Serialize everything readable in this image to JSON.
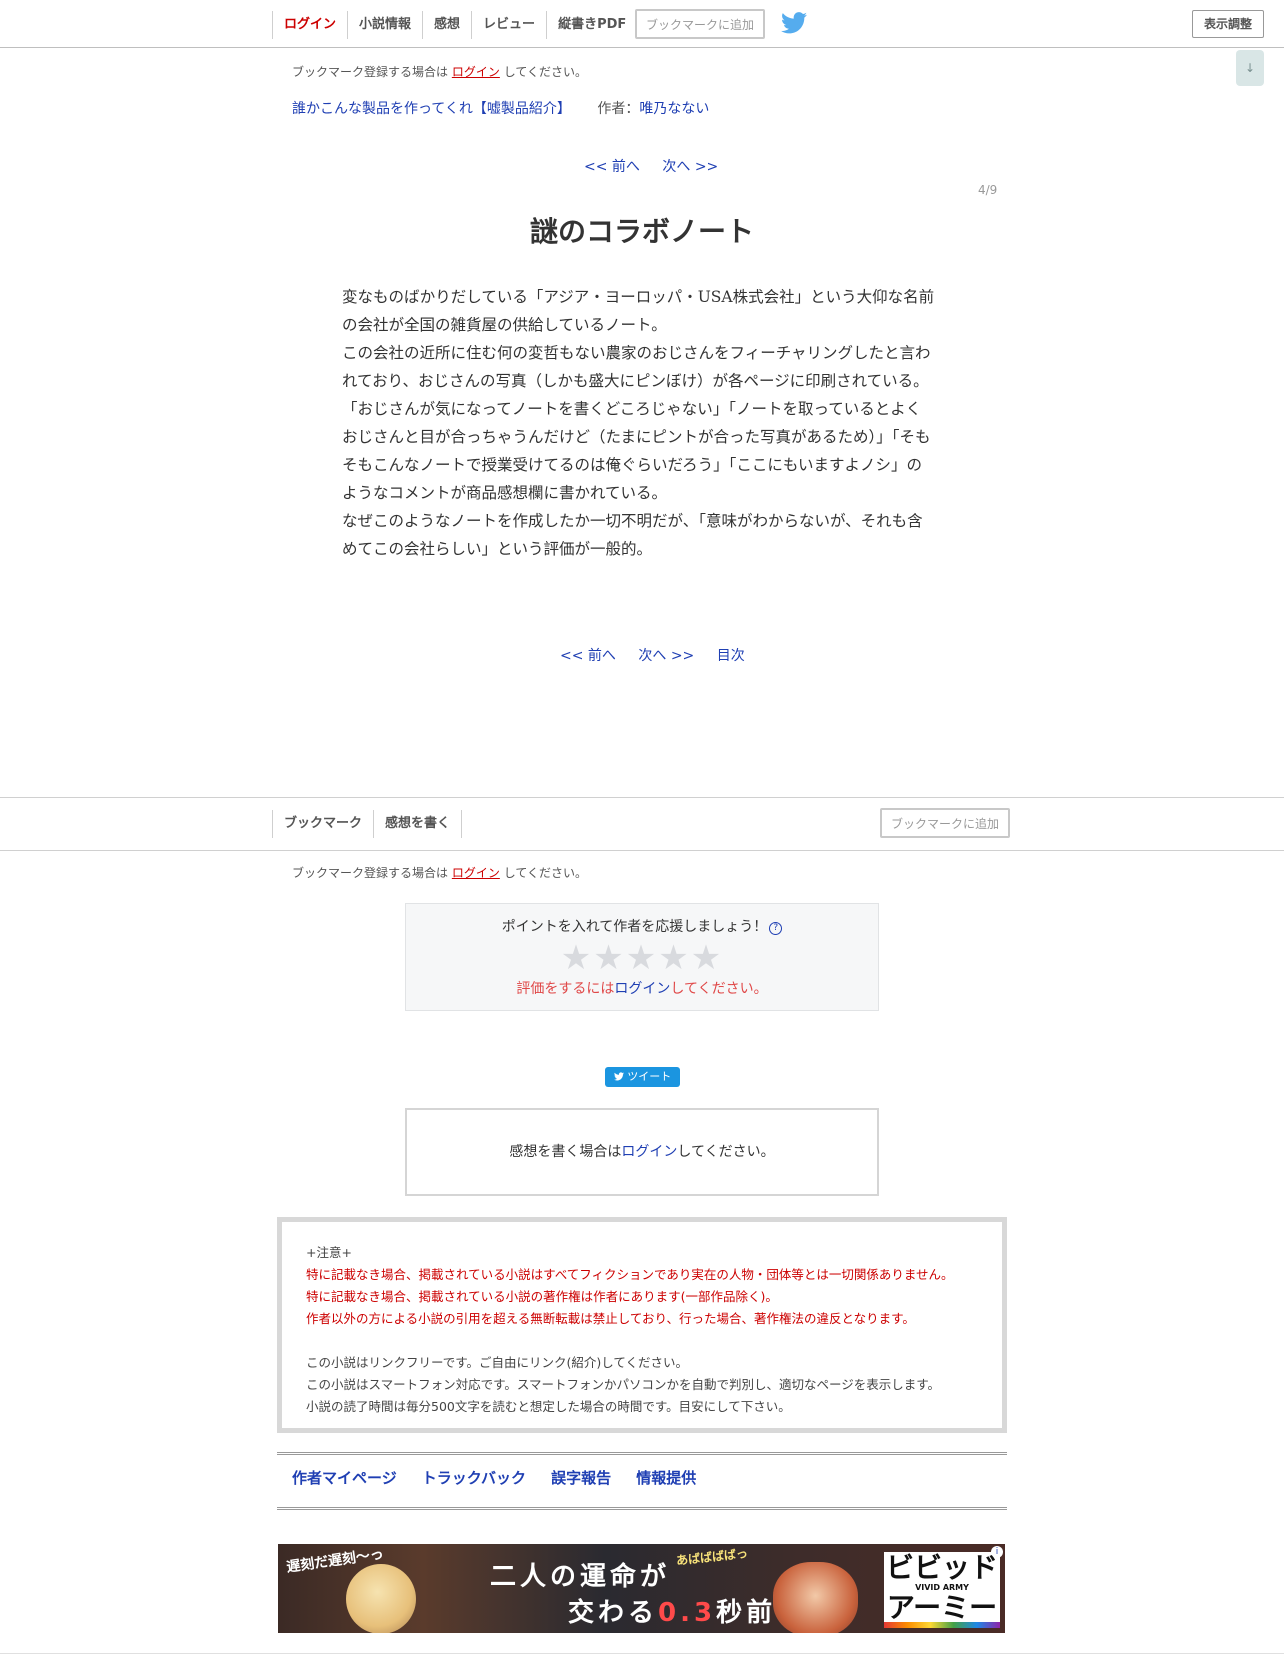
{
  "nav": {
    "items": [
      "ログイン",
      "小説情報",
      "感想",
      "レビュー",
      "縦書きPDF"
    ],
    "bookmark_add": "ブックマークに追加",
    "display_settings": "表示調整",
    "scroll_down": "↓"
  },
  "bookmark_note": {
    "before": "ブックマーク登録する場合は",
    "login": "ログイン",
    "after": "してください。"
  },
  "novel": {
    "title": "誰かこんな製品を作ってくれ【嘘製品紹介】",
    "author_label": "作者：",
    "author": "唯乃なない"
  },
  "pager_top": {
    "prev": "<< 前へ",
    "next": "次へ >>"
  },
  "page_number": "4/9",
  "chapter": {
    "title": "謎のコラボノート",
    "paragraphs": [
      "変なものばかりだしている「アジア・ヨーロッパ・USA株式会社」という大仰な名前の会社が全国の雑貨屋の供給しているノート。",
      "この会社の近所に住む何の変哲もない農家のおじさんをフィーチャリングしたと言われており、おじさんの写真（しかも盛大にピンぼけ）が各ページに印刷されている。",
      "「おじさんが気になってノートを書くどころじゃない」「ノートを取っているとよくおじさんと目が合っちゃうんだけど（たまにピントが合った写真があるため）」「そもそもこんなノートで授業受けてるのは俺ぐらいだろう」「ここにもいますよノシ」のようなコメントが商品感想欄に書かれている。",
      "なぜこのようなノートを作成したか一切不明だが、「意味がわからないが、それも含めてこの会社らしい」という評価が一般的。"
    ]
  },
  "pager_bottom": {
    "prev": "<< 前へ",
    "next": "次へ >>",
    "toc": "目次"
  },
  "subnav": {
    "items": [
      "ブックマーク",
      "感想を書く"
    ],
    "bookmark_add": "ブックマークに追加"
  },
  "points": {
    "title": "ポイントを入れて作者を応援しましょう！",
    "help": "?",
    "stars": "★★★★★",
    "rating": 0,
    "login_before": "評価をするには",
    "login_link": "ログイン",
    "login_after": "してください。"
  },
  "tweet": "ツイート",
  "impression": {
    "before": "感想を書く場合は",
    "link": "ログイン",
    "after": "してください。"
  },
  "notice": {
    "heading": "+注意+",
    "red_lines": [
      "特に記載なき場合、掲載されている小説はすべてフィクションであり実在の人物・団体等とは一切関係ありません。",
      "特に記載なき場合、掲載されている小説の著作権は作者にあります(一部作品除く)。",
      "作者以外の方による小説の引用を超える無断転載は禁止しており、行った場合、著作権法の違反となります。"
    ],
    "lines": [
      "この小説はリンクフリーです。ご自由にリンク(紹介)してください。",
      "この小説はスマートフォン対応です。スマートフォンかパソコンかを自動で判別し、適切なページを表示します。",
      "小説の読了時間は毎分500文字を読むと想定した場合の時間です。目安にして下さい。"
    ]
  },
  "footer_links": [
    "作者マイページ",
    "トラックバック",
    "誤字報告",
    "情報提供"
  ],
  "banner": {
    "tag": "遅刻だ遅刻〜っ",
    "exclaim": "あばばばばっ",
    "line1": "二人の運命が",
    "line2_a": "交わる",
    "line2_num": "0.3",
    "line2_b": "秒前",
    "logo_top": "ビビッド",
    "logo_sub": "VIVID ARMY",
    "logo_bottom": "アーミー",
    "ad_info": "i"
  },
  "colors": {
    "link": "#1f3fb3",
    "login_red": "#cc0000",
    "notice_red": "#cc0000",
    "tweet_blue": "#1b95e0",
    "twitter_icon": "#55acee"
  }
}
